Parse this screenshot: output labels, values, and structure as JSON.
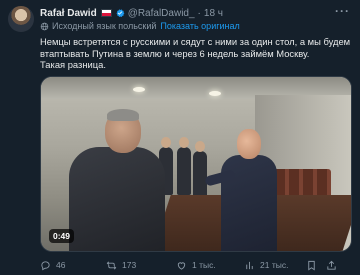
{
  "author": {
    "name": "Rafał Dawid",
    "handle": "@RafalDawid_",
    "separator": "·",
    "time": "18 ч"
  },
  "translation": {
    "notice": "Исходный язык польский",
    "show_original": "Показать оригинал"
  },
  "tweet_text": {
    "line1": "Немцы встретятся с русскими и сядут с ними за один стол, а мы будем",
    "line2": "втаптывать Путина в землю и через 6 недель займём Москву.",
    "line3": "Такая разница."
  },
  "media": {
    "duration": "0:49"
  },
  "actions": {
    "replies": "46",
    "retweets": "173",
    "likes": "1 тыс.",
    "views": "21 тыс."
  },
  "colors": {
    "background": "#15202b",
    "text": "#e7e9ea",
    "secondary": "#8b98a5",
    "accent": "#1d9bf0"
  },
  "icons": [
    "more-icon",
    "verified-badge-icon",
    "flag-poland-icon",
    "globe-icon",
    "reply-icon",
    "retweet-icon",
    "like-icon",
    "views-icon",
    "bookmark-icon",
    "share-icon"
  ]
}
